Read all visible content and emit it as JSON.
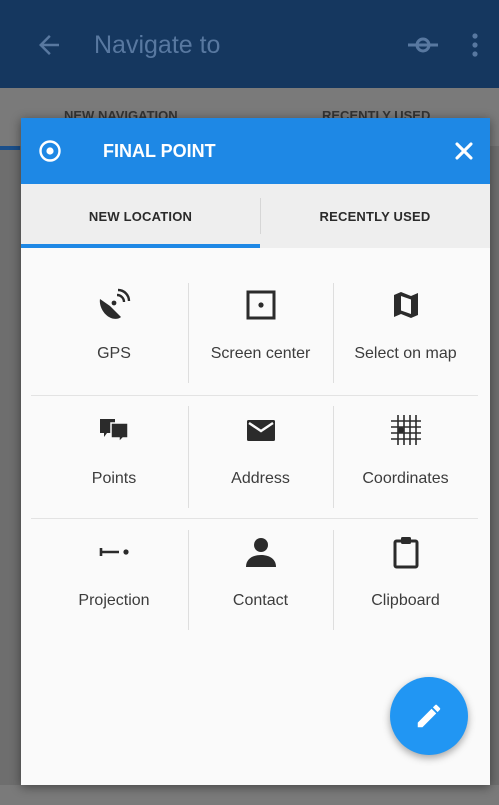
{
  "background_app": {
    "title": "Navigate to",
    "tabs": [
      "NEW NAVIGATION",
      "RECENTLY USED"
    ],
    "back_icon": "arrow-left-icon",
    "route_icon": "route-icon",
    "more_icon": "more-vertical-icon"
  },
  "dialog": {
    "title": "FINAL POINT",
    "title_icon": "target-icon",
    "close_icon": "close-icon",
    "tabs": [
      {
        "label": "NEW LOCATION",
        "selected": true
      },
      {
        "label": "RECENTLY USED",
        "selected": false
      }
    ],
    "options": [
      {
        "label": "GPS",
        "icon": "satellite-dish-icon"
      },
      {
        "label": "Screen center",
        "icon": "screen-center-icon"
      },
      {
        "label": "Select on map",
        "icon": "map-icon"
      },
      {
        "label": "Points",
        "icon": "points-icon"
      },
      {
        "label": "Address",
        "icon": "envelope-icon"
      },
      {
        "label": "Coordinates",
        "icon": "coordinates-grid-icon"
      },
      {
        "label": "Projection",
        "icon": "projection-icon"
      },
      {
        "label": "Contact",
        "icon": "contact-icon"
      },
      {
        "label": "Clipboard",
        "icon": "clipboard-icon"
      }
    ],
    "fab_icon": "pencil-icon"
  },
  "colors": {
    "toolbar": "#15375f",
    "dialog_header": "#1e88e5",
    "tab_indicator": "#1e88e5",
    "fab": "#2196f3",
    "icon": "#2b2b2b"
  }
}
